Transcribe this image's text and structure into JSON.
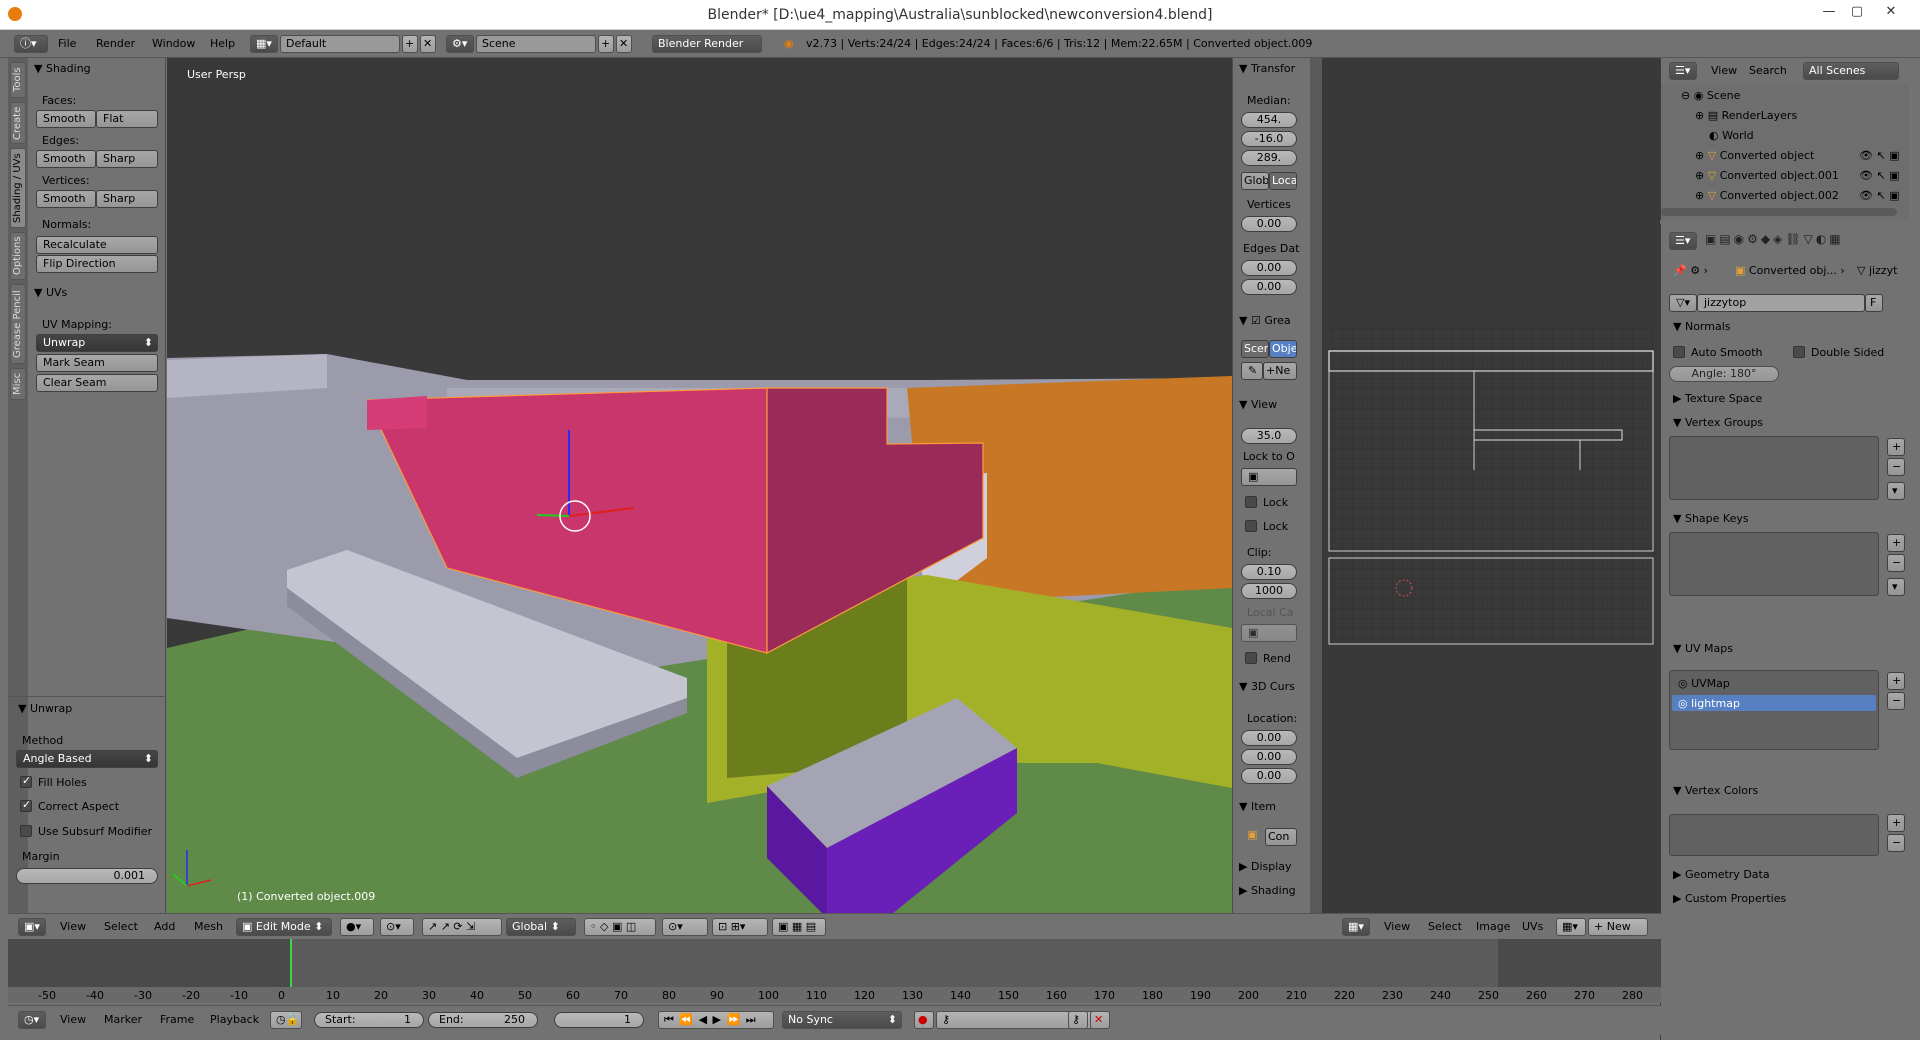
{
  "window": {
    "title": "Blender* [D:\\ue4_mapping\\Australia\\sunblocked\\newconversion4.blend]",
    "minimize": "—",
    "maximize": "▢",
    "close": "✕"
  },
  "menubar": {
    "items": [
      "File",
      "Render",
      "Window",
      "Help"
    ],
    "layout": "Default",
    "scene": "Scene",
    "engine": "Blender Render",
    "stats": "v2.73 | Verts:24/24 | Edges:24/24 | Faces:6/6 | Tris:12 | Mem:22.65M | Converted object.009"
  },
  "tabs": [
    "Tools",
    "Create",
    "Shading / UVs",
    "Options",
    "Grease Pencil",
    "Misc"
  ],
  "shading": {
    "header": "Shading",
    "faces": "Faces:",
    "edges": "Edges:",
    "vertices": "Vertices:",
    "smooth": "Smooth",
    "flat": "Flat",
    "sharp": "Sharp",
    "normals": "Normals:",
    "recalculate": "Recalculate",
    "flip": "Flip Direction"
  },
  "uvs": {
    "header": "UVs",
    "mapping": "UV Mapping:",
    "unwrap": "Unwrap",
    "mark_seam": "Mark Seam",
    "clear_seam": "Clear Seam"
  },
  "unwrap_op": {
    "header": "Unwrap",
    "method": "Method",
    "method_val": "Angle Based",
    "fill_holes": "Fill Holes",
    "correct_aspect": "Correct Aspect",
    "subsurf": "Use Subsurf Modifier",
    "margin": "Margin",
    "margin_val": "0.001"
  },
  "viewport": {
    "label": "User Persp",
    "object": "(1) Converted object.009"
  },
  "npanel": {
    "transform": "Transfor",
    "median": "Median:",
    "m1": "454.",
    "m2": "-16.0",
    "m3": "289.",
    "glob": "Glob",
    "loca": "Loca",
    "vertices": "Vertices",
    "v_val": "0.00",
    "edges": "Edges Dat",
    "e1": "0.00",
    "e2": "0.00",
    "grease": "Grea",
    "scen": "Scen",
    "obje": "Obje",
    "ne": "Ne",
    "view": "View",
    "lens": "35.0",
    "lock_to": "Lock to O",
    "lock1": "Lock",
    "lock2": "Lock",
    "clip": "Clip:",
    "clip1": "0.10",
    "clip2": "1000",
    "local_ca": "Local Ca",
    "rend": "Rend",
    "cursor": "3D Curs",
    "location": "Location:",
    "l1": "0.00",
    "l2": "0.00",
    "l3": "0.00",
    "item": "Item",
    "con": "Con",
    "display": "Display",
    "shading": "Shading"
  },
  "outliner": {
    "view": "View",
    "search": "Search",
    "all_scenes": "All Scenes",
    "items": [
      "Scene",
      "RenderLayers",
      "World",
      "Converted object",
      "Converted object.001",
      "Converted object.002"
    ]
  },
  "props": {
    "breadcrumb_obj": "Converted obj...",
    "breadcrumb_mesh": "jizzyt",
    "mesh_name": "jizzytop",
    "f": "F",
    "normals": "Normals",
    "auto_smooth": "Auto Smooth",
    "double_sided": "Double Sided",
    "angle": "Angle:",
    "angle_val": "180°",
    "texture_space": "Texture Space",
    "vertex_groups": "Vertex Groups",
    "shape_keys": "Shape Keys",
    "uv_maps": "UV Maps",
    "uvmap1": "UVMap",
    "uvmap2": "lightmap",
    "vertex_colors": "Vertex Colors",
    "geometry_data": "Geometry Data",
    "custom_props": "Custom Properties"
  },
  "view3d_header": {
    "items": [
      "View",
      "Select",
      "Add",
      "Mesh"
    ],
    "mode": "Edit Mode",
    "orientation": "Global"
  },
  "uv_header": {
    "items": [
      "View",
      "Select",
      "Image",
      "UVs"
    ],
    "new": "New"
  },
  "timeline": {
    "items": [
      "View",
      "Marker",
      "Frame",
      "Playback"
    ],
    "start": "Start:",
    "start_val": "1",
    "end": "End:",
    "end_val": "250",
    "current": "1",
    "sync": "No Sync",
    "ticks": [
      "-50",
      "-40",
      "-30",
      "-20",
      "-10",
      "0",
      "10",
      "20",
      "30",
      "40",
      "50",
      "60",
      "70",
      "80",
      "90",
      "100",
      "110",
      "120",
      "130",
      "140",
      "150",
      "160",
      "170",
      "180",
      "190",
      "200",
      "210",
      "220",
      "230",
      "240",
      "250",
      "260",
      "270",
      "280"
    ]
  },
  "colors": {
    "pink": "#c8366b",
    "orange": "#c87825",
    "yellow": "#a3b128",
    "purple": "#6a1fb8",
    "ground": "#5f8a48",
    "gray": "#9b9bac"
  }
}
